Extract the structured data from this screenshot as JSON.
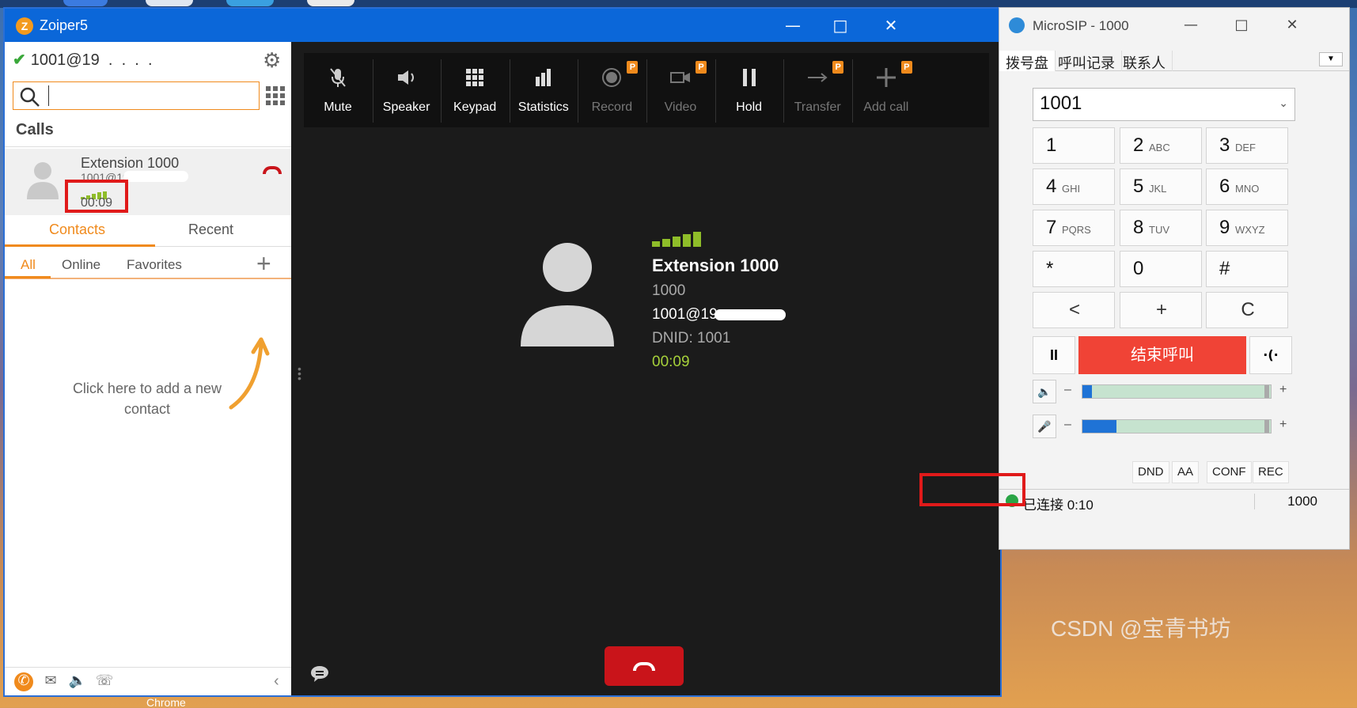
{
  "zoiper": {
    "title": "Zoiper5",
    "account": "1001@19 . . . .",
    "search_placeholder": "",
    "calls_header": "Calls",
    "call": {
      "name": "Extension 1000",
      "uri": "1001@19.",
      "time": "00:09"
    },
    "tabs": {
      "contacts": "Contacts",
      "recent": "Recent"
    },
    "subtabs": {
      "all": "All",
      "online": "Online",
      "favorites": "Favorites"
    },
    "add_hint": "Click here to add a new contact",
    "toolbar": [
      {
        "label": "Mute",
        "icon": "mute-icon",
        "enabled": true,
        "premium": false
      },
      {
        "label": "Speaker",
        "icon": "speaker-icon",
        "enabled": true,
        "premium": false
      },
      {
        "label": "Keypad",
        "icon": "keypad-icon",
        "enabled": true,
        "premium": false
      },
      {
        "label": "Statistics",
        "icon": "statistics-icon",
        "enabled": true,
        "premium": false
      },
      {
        "label": "Record",
        "icon": "record-icon",
        "enabled": false,
        "premium": true
      },
      {
        "label": "Video",
        "icon": "video-icon",
        "enabled": false,
        "premium": true
      },
      {
        "label": "Hold",
        "icon": "hold-icon",
        "enabled": true,
        "premium": false
      },
      {
        "label": "Transfer",
        "icon": "transfer-icon",
        "enabled": false,
        "premium": true
      },
      {
        "label": "Add call",
        "icon": "add-call-icon",
        "enabled": false,
        "premium": true
      }
    ],
    "premium_badge": "P",
    "active_call": {
      "name": "Extension 1000",
      "number": "1000",
      "uri": "1001@19",
      "dnid": "DNID: 1001",
      "time": "00:09"
    },
    "colors": {
      "accent": "#f08a1c",
      "title_bar": "#0b67d9",
      "signal": "#8fbd29",
      "hangup": "#c9141a"
    }
  },
  "microsip": {
    "title": "MicroSIP - 1000",
    "tabs": [
      "拨号盘",
      "呼叫记录",
      "联系人"
    ],
    "number": "1001",
    "keys": [
      {
        "d": "1",
        "s": ""
      },
      {
        "d": "2",
        "s": "ABC"
      },
      {
        "d": "3",
        "s": "DEF"
      },
      {
        "d": "4",
        "s": "GHI"
      },
      {
        "d": "5",
        "s": "JKL"
      },
      {
        "d": "6",
        "s": "MNO"
      },
      {
        "d": "7",
        "s": "PQRS"
      },
      {
        "d": "8",
        "s": "TUV"
      },
      {
        "d": "9",
        "s": "WXYZ"
      },
      {
        "d": "*",
        "s": ""
      },
      {
        "d": "0",
        "s": ""
      },
      {
        "d": "#",
        "s": ""
      }
    ],
    "nav_keys": [
      "<",
      "+",
      "C"
    ],
    "end_call": "结束呼叫",
    "pause_label": "II",
    "transfer_label": "·(·",
    "vol_minus": "–",
    "vol_plus": "+",
    "speaker_level": 0.05,
    "mic_level": 0.18,
    "buttons": [
      "DND",
      "AA",
      "CONF",
      "REC"
    ],
    "status": "已连接 0:10",
    "status_ext": "1000",
    "colors": {
      "end_call": "#f04336",
      "status_ok": "#2aa546"
    }
  },
  "watermark": "CSDN @宝青书坊",
  "desktop_label": "Chrome"
}
